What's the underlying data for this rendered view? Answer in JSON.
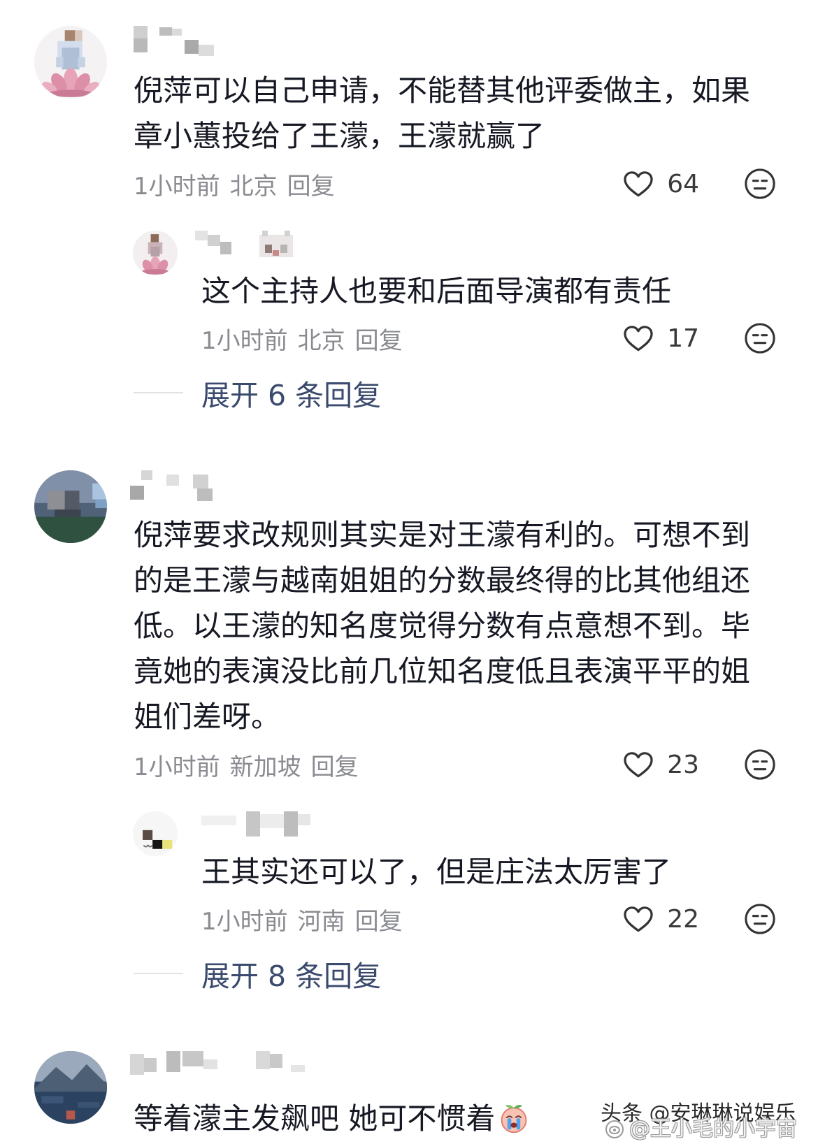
{
  "comments": [
    {
      "text": "倪萍可以自己申请，不能替其他评委做主，如果章小蕙投给了王濛，王濛就赢了",
      "time": "1小时前",
      "location": "北京",
      "reply_label": "回复",
      "likes": "64",
      "replies": [
        {
          "text": "这个主持人也要和后面导演都有责任",
          "time": "1小时前",
          "location": "北京",
          "reply_label": "回复",
          "likes": "17"
        }
      ],
      "expand_label": "展开 6 条回复"
    },
    {
      "text": "倪萍要求改规则其实是对王濛有利的。可想不到的是王濛与越南姐姐的分数最终得的比其他组还低。以王濛的知名度觉得分数有点意想不到。毕竟她的表演没比前几位知名度低且表演平平的姐姐们差呀。",
      "time": "1小时前",
      "location": "新加坡",
      "reply_label": "回复",
      "likes": "23",
      "replies": [
        {
          "text": "王其实还可以了，但是庄法太厉害了",
          "time": "1小时前",
          "location": "河南",
          "reply_label": "回复",
          "likes": "22"
        }
      ],
      "expand_label": "展开 8 条回复"
    },
    {
      "text": "等着濛主发飙吧 她可不惯着",
      "emoji": "crying-peach-emoji"
    }
  ],
  "watermarks": {
    "toutiao": "头条 @安琳琳说娱乐",
    "weibo": "@王小毛的小宇宙"
  },
  "icons": {
    "like": "heart-outline-icon",
    "dislike": "neutral-face-icon",
    "weibo_logo": "weibo-logo-icon"
  },
  "colors": {
    "background": "#ffffff",
    "text": "#161823",
    "meta": "#8a8b91",
    "count": "#3a3a3a",
    "expand": "#3b4b6e",
    "divider": "#e2e2e2"
  }
}
